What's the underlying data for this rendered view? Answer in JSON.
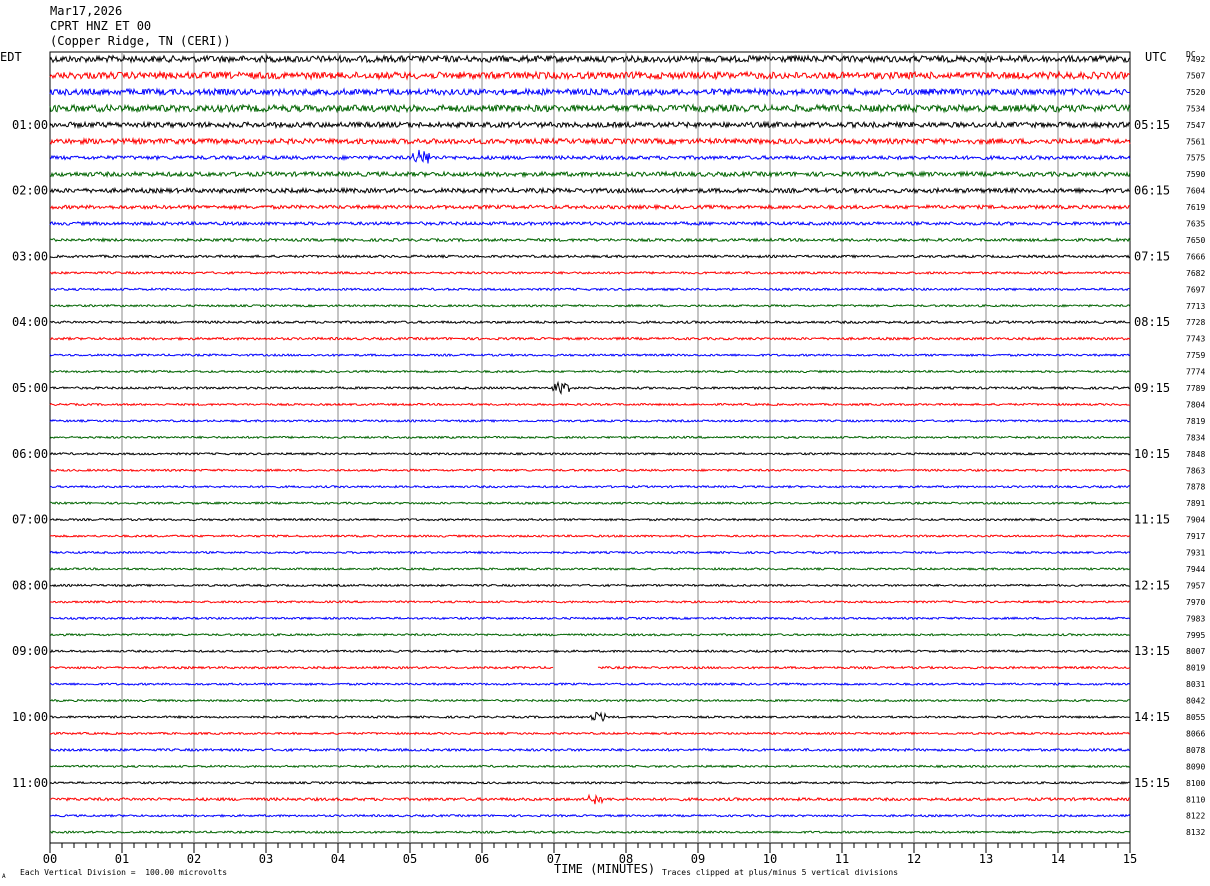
{
  "header": {
    "date": "Mar17,2026",
    "station": "CPRT HNZ ET 00",
    "location": "(Copper Ridge, TN (CERI))"
  },
  "left_zone": "EDT",
  "right_zone": "UTC",
  "dc_label": "DC",
  "footer": {
    "scale_note": "Each Vertical Division =  100.00 microvolts",
    "time_axis_label": "TIME (MINUTES)",
    "clip_note": "Traces clipped at plus/minus 5 vertical divisions",
    "corner_mark": "A"
  },
  "chart_data": {
    "type": "line",
    "title": "CPRT HNZ ET 00",
    "xlabel": "TIME (MINUTES)",
    "ylabel": "",
    "xlim": [
      0,
      15
    ],
    "x_ticks": [
      "00",
      "01",
      "02",
      "03",
      "04",
      "05",
      "06",
      "07",
      "08",
      "09",
      "10",
      "11",
      "12",
      "13",
      "14",
      "15"
    ],
    "trace_minutes": 15,
    "trace_colors": [
      "#000000",
      "#ff0000",
      "#0000ff",
      "#006400"
    ],
    "left_hour_labels": [
      "01:00",
      "02:00",
      "03:00",
      "04:00",
      "05:00",
      "06:00",
      "07:00",
      "08:00",
      "09:00",
      "10:00",
      "11:00"
    ],
    "right_hour_labels": [
      "05:15",
      "06:15",
      "07:15",
      "08:15",
      "09:15",
      "10:15",
      "11:15",
      "12:15",
      "13:15",
      "14:15",
      "15:15"
    ],
    "dc_offsets": [
      "7492",
      "7507",
      "7520",
      "7534",
      "7547",
      "7561",
      "7575",
      "7590",
      "7604",
      "7619",
      "7635",
      "7650",
      "7666",
      "7682",
      "7697",
      "7713",
      "7728",
      "7743",
      "7759",
      "7774",
      "7789",
      "7804",
      "7819",
      "7834",
      "7848",
      "7863",
      "7878",
      "7891",
      "7904",
      "7917",
      "7931",
      "7944",
      "7957",
      "7970",
      "7983",
      "7995",
      "8007",
      "8019",
      "8031",
      "8042",
      "8055",
      "8066",
      "8078",
      "8090",
      "8100",
      "8110",
      "8122",
      "8132"
    ],
    "trace_noise_level": [
      3.2,
      3.4,
      3.0,
      3.4,
      2.6,
      2.6,
      1.8,
      2.2,
      2.2,
      1.8,
      1.6,
      1.4,
      1.2,
      1.1,
      1.1,
      1.0,
      1.2,
      1.2,
      1.0,
      1.0,
      1.1,
      1.0,
      1.0,
      1.0,
      1.0,
      1.0,
      1.0,
      1.0,
      1.0,
      1.0,
      1.0,
      1.0,
      1.0,
      1.0,
      1.0,
      1.0,
      1.0,
      1.1,
      1.0,
      1.0,
      1.0,
      1.0,
      1.2,
      1.0,
      1.0,
      1.4,
      1.0,
      1.0
    ],
    "data_gap": {
      "trace_index": 37,
      "start_minute": 7.0,
      "end_minute": 7.6
    },
    "events": [
      {
        "trace_index": 6,
        "minute": 5.15,
        "amplitude": 7
      },
      {
        "trace_index": 45,
        "minute": 7.6,
        "amplitude": 5
      },
      {
        "trace_index": 20,
        "minute": 7.1,
        "amplitude": 5
      },
      {
        "trace_index": 40,
        "minute": 7.6,
        "amplitude": 5
      }
    ],
    "grid": true,
    "scale": "Each Vertical Division =  100.00 microvolts",
    "clip_note": "Traces clipped at plus/minus 5 vertical divisions"
  }
}
